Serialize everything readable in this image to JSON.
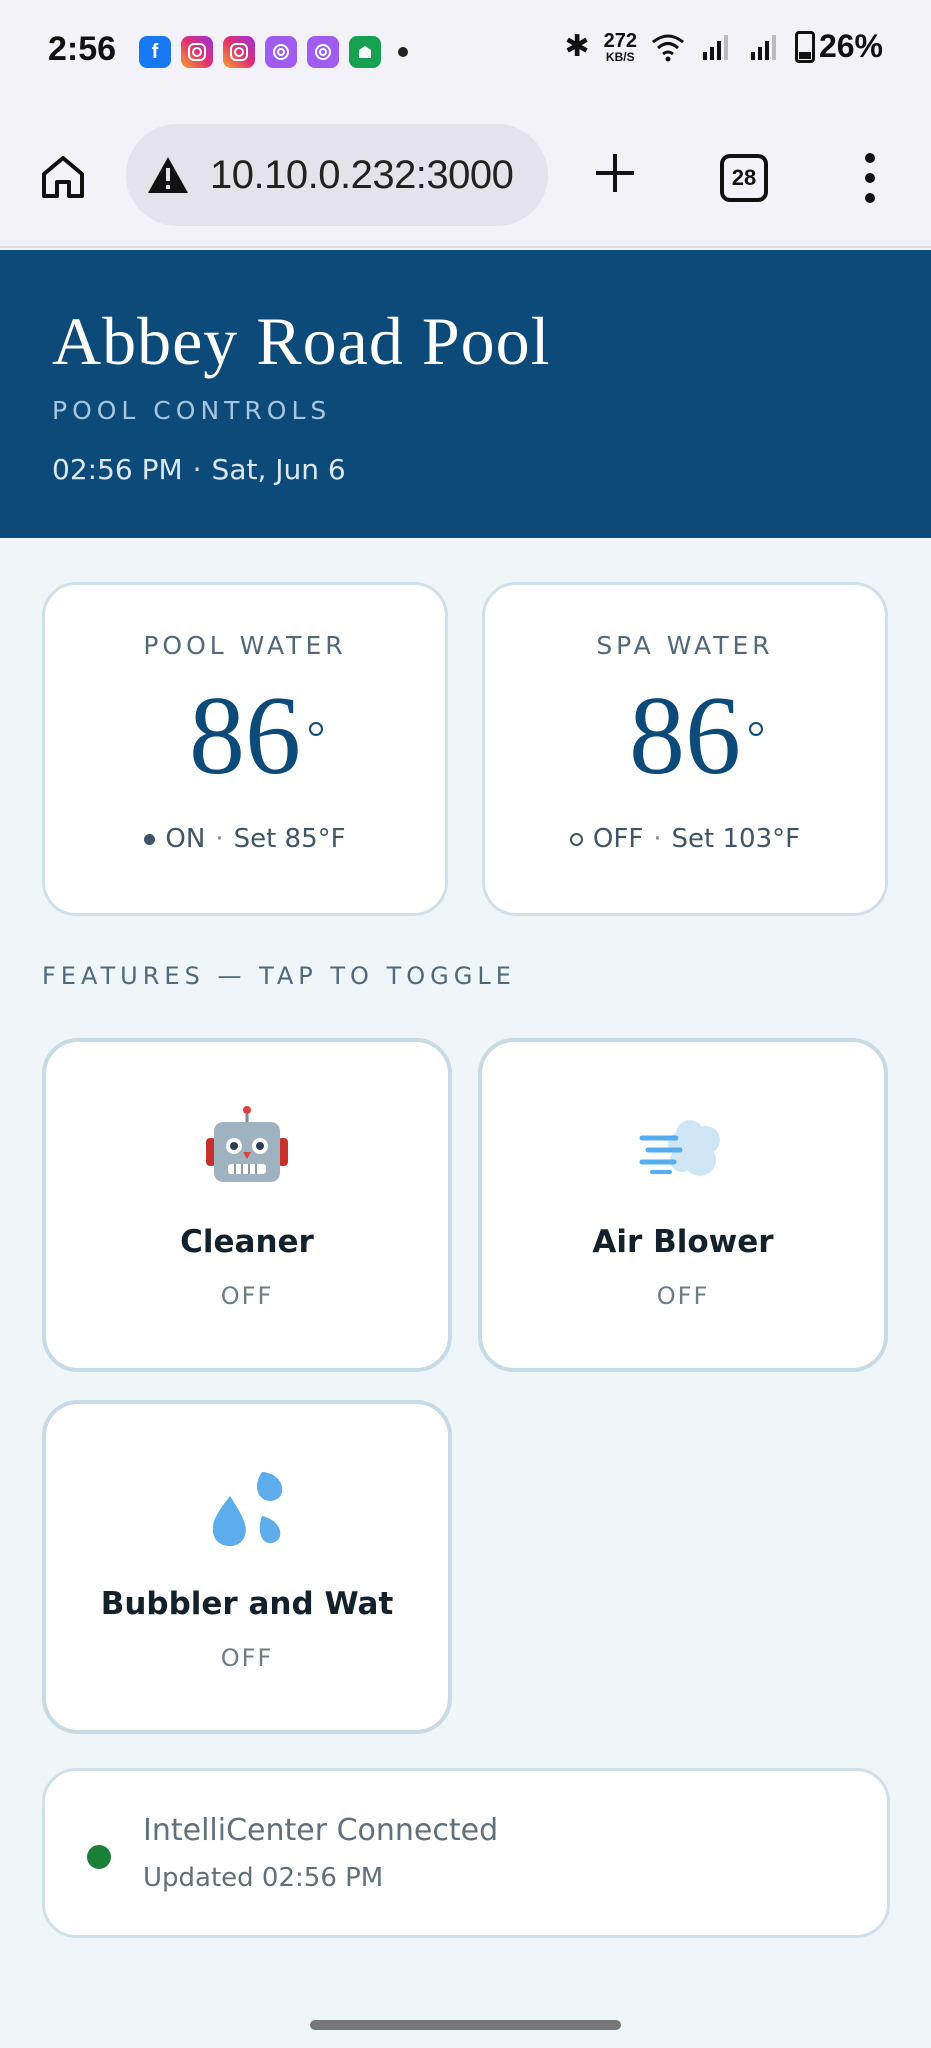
{
  "status_bar": {
    "time": "2:56",
    "network_speed": "272",
    "network_speed_unit": "KB/S",
    "battery_percent": "26%",
    "battery_level": 0.26,
    "notification_icons": [
      "facebook-icon",
      "instagram-icon",
      "instagram-icon",
      "threads-icon",
      "threads-icon",
      "app-icon"
    ]
  },
  "browser": {
    "url": "10.10.0.232:3000",
    "tab_count": "28"
  },
  "header": {
    "title": "Abbey Road Pool",
    "subtitle": "POOL CONTROLS",
    "time": "02:56 PM",
    "separator": "·",
    "date": "Sat, Jun 6"
  },
  "water": {
    "pool": {
      "label": "POOL WATER",
      "temp": "86",
      "state": "ON",
      "separator": "·",
      "setpoint": "Set 85°F"
    },
    "spa": {
      "label": "SPA WATER",
      "temp": "86",
      "state": "OFF",
      "separator": "·",
      "setpoint": "Set 103°F"
    }
  },
  "features": {
    "section_title": "FEATURES — TAP TO TOGGLE",
    "items": [
      {
        "name": "Cleaner",
        "state": "OFF",
        "icon": "robot-icon"
      },
      {
        "name": "Air Blower",
        "state": "OFF",
        "icon": "dash-wind-icon"
      },
      {
        "name": "Bubbler and Wat",
        "state": "OFF",
        "icon": "water-drops-icon"
      }
    ]
  },
  "connection": {
    "title": "IntelliCenter Connected",
    "updated": "Updated 02:56 PM",
    "status_color": "#1a7f37"
  },
  "colors": {
    "header_bg": "#0c4a79",
    "page_bg": "#eef6f9",
    "accent_text": "#0c4a79"
  }
}
